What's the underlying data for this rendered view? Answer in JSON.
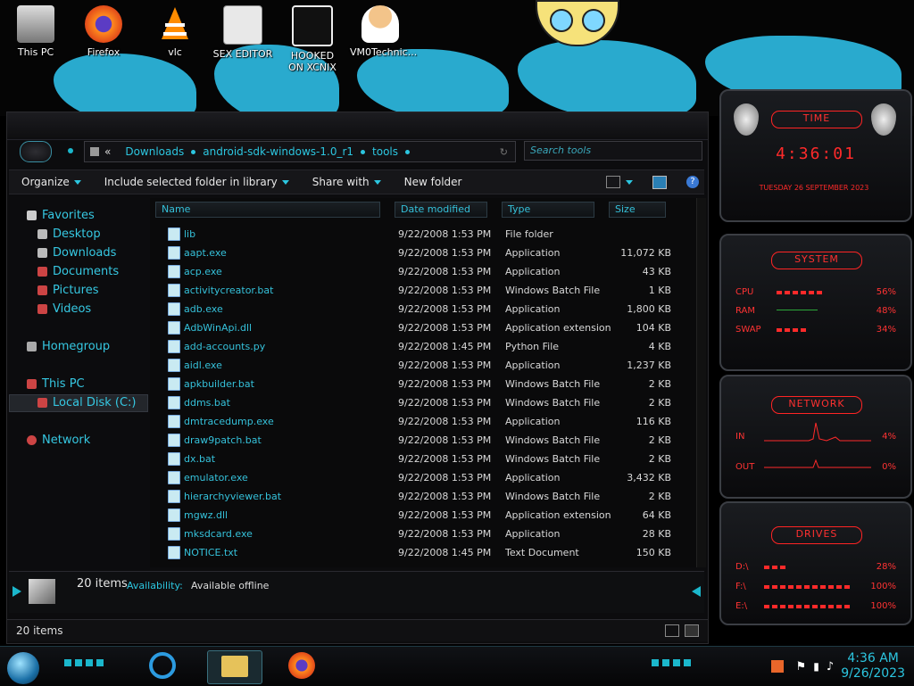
{
  "desktop": {
    "icons": [
      {
        "label": "This PC"
      },
      {
        "label": "Firefox"
      },
      {
        "label": "vlc"
      },
      {
        "label": "SEX EDITOR"
      },
      {
        "label": "HOOKED ON XCNIX"
      },
      {
        "label": "VM0Technic..."
      }
    ]
  },
  "explorer": {
    "address": {
      "crumbs": [
        "«",
        "Downloads",
        "android-sdk-windows-1.0_r1",
        "tools"
      ],
      "search_placeholder": "Search tools"
    },
    "toolbar": {
      "organize": "Organize",
      "include": "Include selected folder in library",
      "share": "Share with",
      "new_folder": "New folder"
    },
    "nav": {
      "favorites": "Favorites",
      "desktop": "Desktop",
      "downloads": "Downloads",
      "documents": "Documents",
      "pictures": "Pictures",
      "videos": "Videos",
      "homegroup": "Homegroup",
      "this_pc": "This PC",
      "local_disk": "Local Disk (C:)",
      "network": "Network"
    },
    "columns": {
      "name": "Name",
      "date": "Date modified",
      "type": "Type",
      "size": "Size"
    },
    "files": [
      {
        "name": "lib",
        "date": "9/22/2008 1:53 PM",
        "type": "File folder",
        "size": ""
      },
      {
        "name": "aapt.exe",
        "date": "9/22/2008 1:53 PM",
        "type": "Application",
        "size": "11,072 KB"
      },
      {
        "name": "acp.exe",
        "date": "9/22/2008 1:53 PM",
        "type": "Application",
        "size": "43 KB"
      },
      {
        "name": "activitycreator.bat",
        "date": "9/22/2008 1:53 PM",
        "type": "Windows Batch File",
        "size": "1 KB"
      },
      {
        "name": "adb.exe",
        "date": "9/22/2008 1:53 PM",
        "type": "Application",
        "size": "1,800 KB"
      },
      {
        "name": "AdbWinApi.dll",
        "date": "9/22/2008 1:53 PM",
        "type": "Application extension",
        "size": "104 KB"
      },
      {
        "name": "add-accounts.py",
        "date": "9/22/2008 1:45 PM",
        "type": "Python File",
        "size": "4 KB"
      },
      {
        "name": "aidl.exe",
        "date": "9/22/2008 1:53 PM",
        "type": "Application",
        "size": "1,237 KB"
      },
      {
        "name": "apkbuilder.bat",
        "date": "9/22/2008 1:53 PM",
        "type": "Windows Batch File",
        "size": "2 KB"
      },
      {
        "name": "ddms.bat",
        "date": "9/22/2008 1:53 PM",
        "type": "Windows Batch File",
        "size": "2 KB"
      },
      {
        "name": "dmtracedump.exe",
        "date": "9/22/2008 1:53 PM",
        "type": "Application",
        "size": "116 KB"
      },
      {
        "name": "draw9patch.bat",
        "date": "9/22/2008 1:53 PM",
        "type": "Windows Batch File",
        "size": "2 KB"
      },
      {
        "name": "dx.bat",
        "date": "9/22/2008 1:53 PM",
        "type": "Windows Batch File",
        "size": "2 KB"
      },
      {
        "name": "emulator.exe",
        "date": "9/22/2008 1:53 PM",
        "type": "Application",
        "size": "3,432 KB"
      },
      {
        "name": "hierarchyviewer.bat",
        "date": "9/22/2008 1:53 PM",
        "type": "Windows Batch File",
        "size": "2 KB"
      },
      {
        "name": "mgwz.dll",
        "date": "9/22/2008 1:53 PM",
        "type": "Application extension",
        "size": "64 KB"
      },
      {
        "name": "mksdcard.exe",
        "date": "9/22/2008 1:53 PM",
        "type": "Application",
        "size": "28 KB"
      },
      {
        "name": "NOTICE.txt",
        "date": "9/22/2008 1:45 PM",
        "type": "Text Document",
        "size": "150 KB"
      }
    ],
    "details": {
      "count": "20 items",
      "availability_label": "Availability:",
      "availability_value": "Available offline"
    },
    "status": {
      "count": "20 items"
    }
  },
  "gadgets": {
    "time": {
      "title": "TIME",
      "clock": "4:36:01",
      "date": "TUESDAY 26 SEPTEMBER 2023"
    },
    "system": {
      "title": "SYSTEM",
      "cpu_label": "CPU",
      "cpu": "56%",
      "cpu_level": 0.56,
      "ram_label": "RAM",
      "ram": "48%",
      "ram_level": 0.48,
      "swap_label": "SWAP",
      "swap": "34%",
      "swap_level": 0.34
    },
    "network": {
      "title": "NETWORK",
      "in_label": "IN",
      "in": "4%",
      "out_label": "OUT",
      "out": "0%"
    },
    "drives": {
      "title": "DRIVES",
      "d1_label": "D:\\",
      "d1": "28%",
      "d1_level": 0.28,
      "d2_label": "F:\\",
      "d2": "100%",
      "d2_level": 1.0,
      "d3_label": "E:\\",
      "d3": "100%",
      "d3_level": 1.0
    }
  },
  "taskbar": {
    "time": "4:36 AM",
    "date": "9/26/2023"
  },
  "colors": {
    "accent": "#2cc6e0",
    "gadget_red": "#ff2a2a"
  }
}
